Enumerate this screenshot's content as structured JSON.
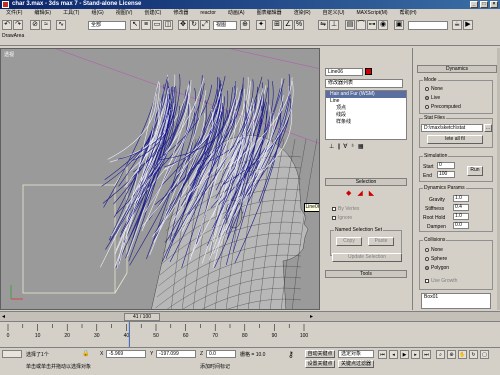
{
  "window": {
    "title": "char 3.max - 3ds max 7 - Stand-alone License"
  },
  "menu": [
    "文件(F)",
    "编辑(E)",
    "工具(T)",
    "组(G)",
    "视图(V)",
    "创建(C)",
    "修改器",
    "reactor",
    "动画(A)",
    "图表编辑器",
    "渲染(R)",
    "自定义(U)",
    "MAXScript(M)",
    "帮助(H)"
  ],
  "toolbar": {
    "selection_set": "全部",
    "view_coord": "视图",
    "drawarea_label": "DrawArea"
  },
  "viewport": {
    "label": "透视"
  },
  "modifier_panel": {
    "object_name": "Line06",
    "modifier_list": "修改器列表",
    "stack": [
      "Hair and Fur (WSM)",
      "Line",
      "顶点",
      "线段",
      "样条线"
    ],
    "selection_title": "Selection",
    "by_vertex": "By Vertex",
    "ignore_back": "Ignore",
    "named_sel_title": "Named Selection Set",
    "copy": "Copy",
    "paste": "Paste",
    "update_selection": "Update Selection",
    "tools_title": "Tools"
  },
  "dynamics_panel": {
    "title": "Dynamics",
    "mode_label": "Mode",
    "modes": [
      {
        "label": "None",
        "on": false
      },
      {
        "label": "Live",
        "on": true
      },
      {
        "label": "Precomputed",
        "on": false
      }
    ],
    "stat_files_label": "Stat Files",
    "stat_path": "D:\\max\\sketch\\stat",
    "delete_all": "lete all fil",
    "simulation_label": "Simulation",
    "start_label": "Start",
    "start_val": "0",
    "end_label": "End",
    "end_val": "100",
    "run": "Run",
    "forces_label": "Dynamics Params",
    "gravity_label": "Gravity",
    "gravity_val": "1.0",
    "stiffness_label": "Stiffness",
    "stiffness_val": "0.4",
    "roothold_label": "Root Hold",
    "roothold_val": "1.0",
    "dampen_label": "Dampen",
    "dampen_val": "0.0",
    "collisions_label": "Collisions",
    "collisions": [
      {
        "label": "None",
        "on": false
      },
      {
        "label": "Sphere",
        "on": false
      },
      {
        "label": "Polygon",
        "on": true
      }
    ],
    "use_growth": "Use Growth",
    "collision_obj": "Box01"
  },
  "time": {
    "slider_label": "41 / 100",
    "ticks": [
      "0",
      "10",
      "20",
      "30",
      "40",
      "50",
      "60",
      "70",
      "80",
      "90",
      "100"
    ]
  },
  "status": {
    "selected": "选择了1个",
    "x_label": "X",
    "x_val": "-5.969",
    "y_label": "Y",
    "y_val": "-197.099",
    "z_label": "Z",
    "z_val": "0.0",
    "grid": "栅格 = 10.0",
    "autokey": "自动关键点",
    "selected_obj": "选定对象",
    "setkey": "设置关键点",
    "keyfilter": "关键点过滤器",
    "prompt": "单击或单击并拖动以选择对象",
    "add_time_tag": "添加时间标记"
  },
  "colors": {
    "hair": "#1a1a8c",
    "viewport_bg": "#9a9a9a",
    "title_bg": "#0a246a"
  }
}
